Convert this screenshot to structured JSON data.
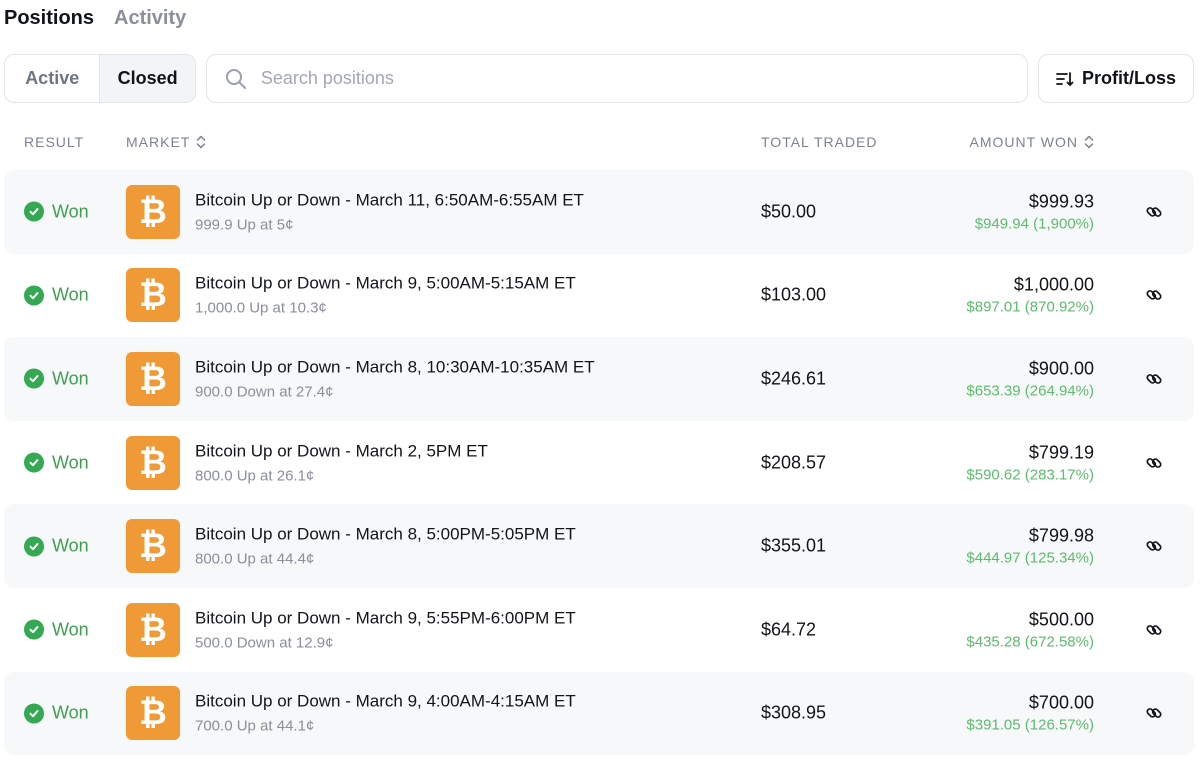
{
  "tabs": [
    {
      "label": "Positions",
      "active": true
    },
    {
      "label": "Activity",
      "active": false
    }
  ],
  "filter": {
    "active_label": "Active",
    "closed_label": "Closed",
    "selected": "Closed"
  },
  "search": {
    "placeholder": "Search positions",
    "value": ""
  },
  "sort": {
    "label": "Profit/Loss"
  },
  "columns": {
    "result": "RESULT",
    "market": "MARKET",
    "total_traded": "TOTAL TRADED",
    "amount_won": "AMOUNT WON"
  },
  "icons": {
    "result": "check-circle-icon",
    "market": "bitcoin-icon",
    "action": "link-icon",
    "search": "search-icon",
    "sort": "sort-icon"
  },
  "colors": {
    "won_green": "#3f9e4f",
    "pnl_green": "#5dbb6c",
    "bitcoin_orange": "#f09a37"
  },
  "rows": [
    {
      "result": "Won",
      "title": "Bitcoin Up or Down - March 11, 6:50AM-6:55AM ET",
      "sub": "999.9 Up at 5¢",
      "traded": "$50.00",
      "amount": "$999.93",
      "pnl": "$949.94 (1,900%)"
    },
    {
      "result": "Won",
      "title": "Bitcoin Up or Down - March 9, 5:00AM-5:15AM ET",
      "sub": "1,000.0 Up at 10.3¢",
      "traded": "$103.00",
      "amount": "$1,000.00",
      "pnl": "$897.01 (870.92%)"
    },
    {
      "result": "Won",
      "title": "Bitcoin Up or Down - March 8, 10:30AM-10:35AM ET",
      "sub": "900.0 Down at 27.4¢",
      "traded": "$246.61",
      "amount": "$900.00",
      "pnl": "$653.39 (264.94%)"
    },
    {
      "result": "Won",
      "title": "Bitcoin Up or Down - March 2, 5PM ET",
      "sub": "800.0 Up at 26.1¢",
      "traded": "$208.57",
      "amount": "$799.19",
      "pnl": "$590.62 (283.17%)"
    },
    {
      "result": "Won",
      "title": "Bitcoin Up or Down - March 8, 5:00PM-5:05PM ET",
      "sub": "800.0 Up at 44.4¢",
      "traded": "$355.01",
      "amount": "$799.98",
      "pnl": "$444.97 (125.34%)"
    },
    {
      "result": "Won",
      "title": "Bitcoin Up or Down - March 9, 5:55PM-6:00PM ET",
      "sub": "500.0 Down at 12.9¢",
      "traded": "$64.72",
      "amount": "$500.00",
      "pnl": "$435.28 (672.58%)"
    },
    {
      "result": "Won",
      "title": "Bitcoin Up or Down - March 9, 4:00AM-4:15AM ET",
      "sub": "700.0 Up at 44.1¢",
      "traded": "$308.95",
      "amount": "$700.00",
      "pnl": "$391.05 (126.57%)"
    }
  ]
}
